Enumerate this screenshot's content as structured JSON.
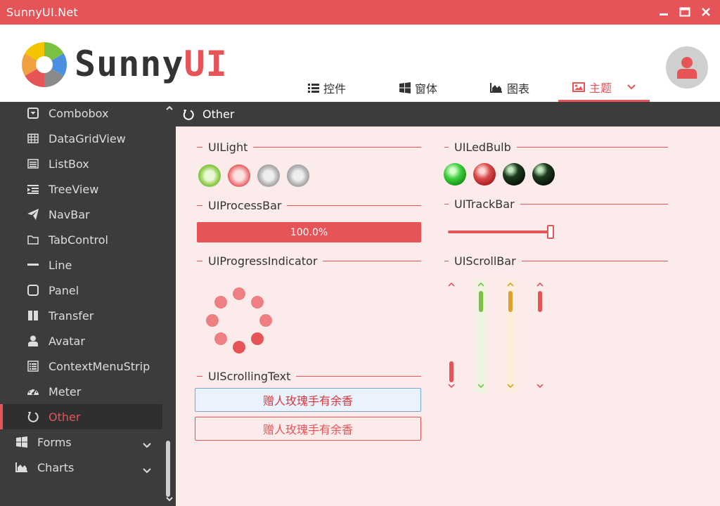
{
  "window": {
    "title": "SunnyUI.Net"
  },
  "logo": {
    "text_a": "Sunny",
    "text_b": "UI"
  },
  "tabs": [
    {
      "label": "控件",
      "icon": "list-icon"
    },
    {
      "label": "窗体",
      "icon": "windows-icon"
    },
    {
      "label": "图表",
      "icon": "area-chart-icon"
    },
    {
      "label": "主题",
      "icon": "image-icon",
      "active": true
    }
  ],
  "sidebar": {
    "items": [
      {
        "label": "Combobox",
        "icon": "caret-square-down-icon"
      },
      {
        "label": "DataGridView",
        "icon": "table-icon"
      },
      {
        "label": "ListBox",
        "icon": "list-alt-icon"
      },
      {
        "label": "TreeView",
        "icon": "indent-icon"
      },
      {
        "label": "NavBar",
        "icon": "paper-plane-icon"
      },
      {
        "label": "TabControl",
        "icon": "folder-icon"
      },
      {
        "label": "Line",
        "icon": "minus-icon"
      },
      {
        "label": "Panel",
        "icon": "square-icon"
      },
      {
        "label": "Transfer",
        "icon": "columns-icon"
      },
      {
        "label": "Avatar",
        "icon": "user-icon"
      },
      {
        "label": "ContextMenuStrip",
        "icon": "list-alt-icon"
      },
      {
        "label": "Meter",
        "icon": "tachometer-icon"
      },
      {
        "label": "Other",
        "icon": "circle-notch-icon",
        "active": true
      }
    ],
    "groups": [
      {
        "label": "Forms",
        "icon": "windows-icon"
      },
      {
        "label": "Charts",
        "icon": "area-chart-icon"
      }
    ]
  },
  "page": {
    "title": "Other"
  },
  "groups": {
    "light": "UILight",
    "processbar": "UIProcessBar",
    "progress_indicator": "UIProgressIndicator",
    "scrolling_text": "UIScrollingText",
    "ledbulb": "UILedBulb",
    "trackbar": "UITrackBar",
    "scrollbar": "UIScrollBar"
  },
  "processbar": {
    "value": 1.0,
    "text": "100.0%"
  },
  "trackbar": {
    "value": 1.0
  },
  "scrolling_text": {
    "line1": "赠人玫瑰手有余香",
    "line2": "赠人玫瑰手有余香"
  },
  "colors": {
    "accent": "#E65458",
    "green": "#7CC242",
    "orange": "#E0A030",
    "content_bg": "#FCEBEB",
    "sidebar_bg": "#3C3C3C"
  }
}
